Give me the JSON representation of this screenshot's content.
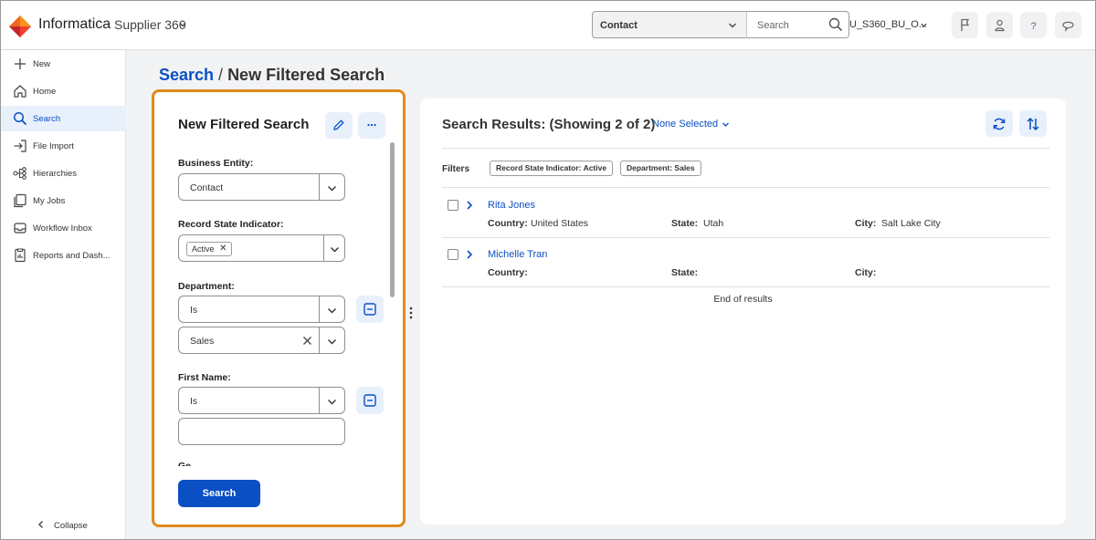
{
  "colors": {
    "accent": "#0b4fc4",
    "highlight": "#e08a1a",
    "logo": "#f26522"
  },
  "header": {
    "brand": "Informatica",
    "app_name": "Supplier 360",
    "entity_select": "Contact",
    "search_placeholder": "Search",
    "org": "U_S360_BU_O..."
  },
  "sidebar": {
    "items": [
      {
        "label": "New",
        "icon": "plus-icon"
      },
      {
        "label": "Home",
        "icon": "home-icon"
      },
      {
        "label": "Search",
        "icon": "search-icon"
      },
      {
        "label": "File Import",
        "icon": "import-icon"
      },
      {
        "label": "Hierarchies",
        "icon": "hierarchy-icon"
      },
      {
        "label": "My Jobs",
        "icon": "jobs-icon"
      },
      {
        "label": "Workflow Inbox",
        "icon": "inbox-icon"
      },
      {
        "label": "Reports and Dash...",
        "icon": "reports-icon"
      }
    ],
    "collapse": "Collapse"
  },
  "breadcrumb": {
    "parent": "Search",
    "separator": "/",
    "current": "New Filtered Search"
  },
  "filter_panel": {
    "title": "New Filtered Search",
    "business_entity": {
      "label": "Business Entity:",
      "value": "Contact"
    },
    "record_state": {
      "label": "Record State Indicator:",
      "chip": "Active"
    },
    "department": {
      "label": "Department:",
      "operator": "Is",
      "value": "Sales"
    },
    "first_name": {
      "label": "First Name:",
      "operator": "Is",
      "value": ""
    },
    "search_button": "Search"
  },
  "results": {
    "title": "Search Results: (Showing 2 of 2)",
    "selection": "None Selected",
    "filters_label": "Filters",
    "filter_chips": [
      "Record State Indicator: Active",
      "Department: Sales"
    ],
    "field_labels": {
      "country": "Country:",
      "state": "State:",
      "city": "City:"
    },
    "rows": [
      {
        "name": "Rita Jones",
        "country": "United States",
        "state": "Utah",
        "city": "Salt Lake City"
      },
      {
        "name": "Michelle Tran",
        "country": "",
        "state": "",
        "city": ""
      }
    ],
    "end_text": "End of results"
  }
}
